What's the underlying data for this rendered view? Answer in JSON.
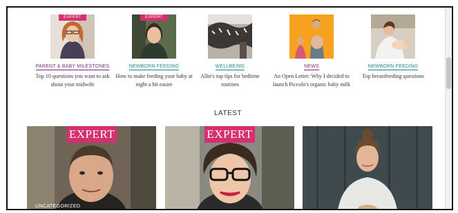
{
  "cards": [
    {
      "badge": "EXPERT",
      "category": "PARENT & BABY MILESTONES",
      "title": "Top 10 questions you want to ask about your midwife",
      "cat_color": "purple"
    },
    {
      "badge": "EXPERT",
      "category": "NEWBORN FEEDING",
      "title": "How to make feeding your baby at night a bit easier",
      "cat_color": "teal"
    },
    {
      "badge": "",
      "category": "WELLBEING",
      "title": "Allie's top tips for bedtime routines",
      "cat_color": "teal"
    },
    {
      "badge": "",
      "category": "NEWS",
      "title": "An Open Letter: Why I decided to launch Piccolo's organic baby milk",
      "cat_color": "purple"
    },
    {
      "badge": "",
      "category": "NEWBORN FEEDING",
      "title": "Top breastfeeding questions",
      "cat_color": "teal"
    }
  ],
  "latest_heading": "LATEST",
  "latest_cards": [
    {
      "badge": "EXPERT",
      "category": "UNCATEGORIZED"
    },
    {
      "badge": "EXPERT",
      "category": ""
    },
    {
      "badge": "",
      "category": ""
    }
  ],
  "colors": {
    "accent_pink": "#d62f6f",
    "purple": "#7a2a80",
    "teal": "#1b8a8f"
  }
}
